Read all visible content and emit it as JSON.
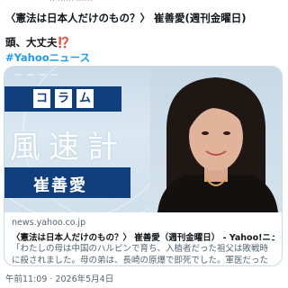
{
  "header": {
    "post_title": "〈憲法は日本人だけのもの？〉 崔善愛(週刊金曜日)",
    "line2_text": "頭、大丈夫",
    "line2_emoji": "⁉️",
    "hashtag": "#Yahooニュース"
  },
  "card": {
    "image": {
      "column_chars": [
        "コ",
        "ラ",
        "ム"
      ],
      "fusoku_title": "風速計",
      "author_name": "崔善愛"
    },
    "domain": "news.yahoo.co.jp",
    "title": "〈憲法は日本人だけのもの？〉 崔善愛（週刊金曜日） - Yahoo!ニュース",
    "description": "「わたしの母は中国のハルビンで育ち、入植者だった祖父は敗戦時に殺されました。母の弟は、長崎の原爆で即死でした。軍医だった父方の伯父は中国で…"
  },
  "footer": {
    "timestamp": "午前11:09 · 2026年5月4日"
  }
}
